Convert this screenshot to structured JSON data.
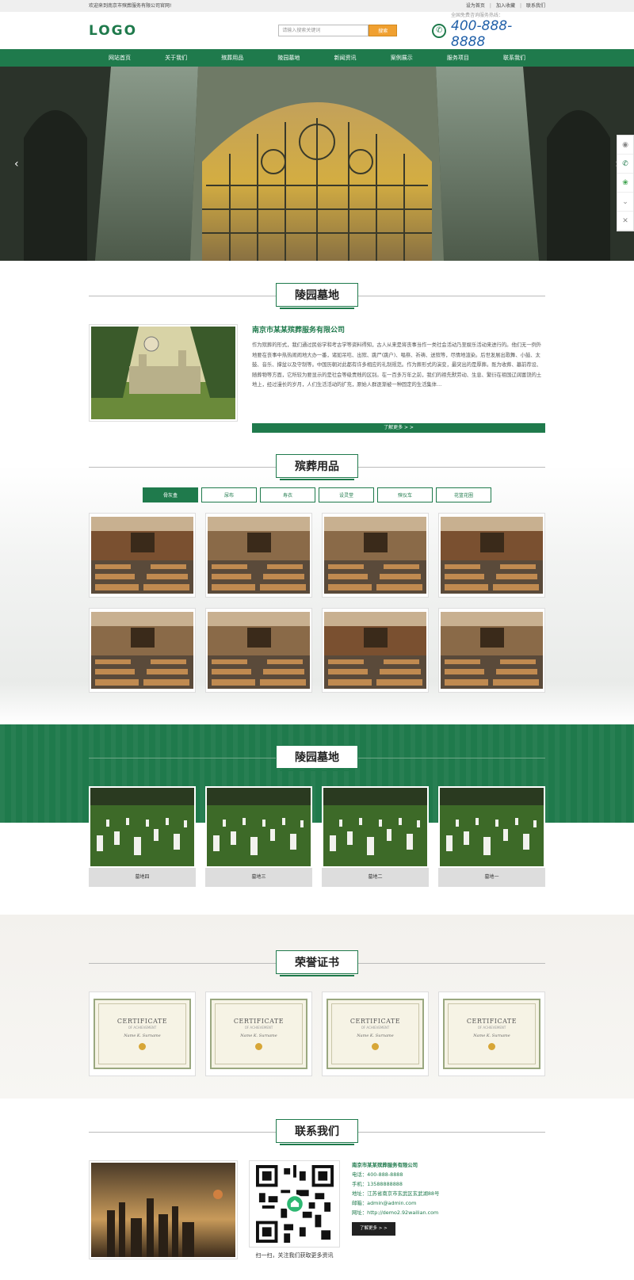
{
  "topbar": {
    "welcome": "欢迎来到南京市殡葬服务有限公司官网!",
    "links": [
      "设为首页",
      "加入收藏",
      "联系我们"
    ]
  },
  "header": {
    "logo": "LOGO",
    "search_placeholder": "请输入搜索关键词",
    "search_button": "搜索",
    "phone_label": "全国免费咨询服务热线：",
    "phone": "400-888-8888"
  },
  "nav": [
    "网站首页",
    "关于我们",
    "殡葬用品",
    "陵园墓地",
    "新闻资讯",
    "案例展示",
    "服务项目",
    "联系我们"
  ],
  "banner": {
    "prev": "‹",
    "next": "›"
  },
  "side_tools": [
    "qq-icon",
    "phone-icon",
    "wechat-icon",
    "down-icon",
    "close-icon"
  ],
  "about": {
    "title": "陵园墓地",
    "company": "南京市某某殡葬服务有限公司",
    "text": "作为殡葬的形式，我们通过民俗学和考古学等资料得知，古人从来是将丧事当作一类社会活动乃至娱乐活动来进行的。他们无一例外地要在丧事中热热闹闹地大办一番，诸如吊唁、出殡、跳尸(跳户)、唱祭、祈祷、送殡等，尽情地渲染。后世发展出歌舞、小鼓、太鼓、音乐、撑盆以及守制等。中国历朝对此都有许多相应的礼制规范。作为葬形式的演变，最突出的是厚葬。既为收葬、墓前荐设、随葬物等方面，它所较为要显示的是社会等级贵贱的区别。在一百多万年之前，我们的祖先默劳动、生息、繁衍在祖国辽阔富饶的土地上，经过漫长的岁月，人们生活活动的扩充，原始人群逐渐被一种固定的生活集体…",
    "more": "了解更多 > >"
  },
  "products": {
    "title": "殡葬用品",
    "tabs": [
      "骨灰盒",
      "尿布",
      "寿衣",
      "设灵堂",
      "殡仪车",
      "花篮花圈"
    ],
    "active_tab": 0
  },
  "cemetery": {
    "title": "陵园墓地",
    "items": [
      "墓地四",
      "墓地三",
      "墓地二",
      "墓地一"
    ]
  },
  "certs": {
    "title": "荣誉证书",
    "cert_title": "CERTIFICATE",
    "cert_sub": "OF ACHIEVEMENT",
    "cert_name": "Name K. Surname",
    "count": 4
  },
  "contact": {
    "title": "联系我们",
    "qr_caption": "扫一扫，关注我们获取更多资讯",
    "company": "南京市某某殡葬服务有限公司",
    "lines": [
      "电话：400-888-8888",
      "手机：13588888888",
      "地址：江苏省南京市玄武区玄武湖88号",
      "邮箱：admin@admin.com",
      "网址：http://demo2.92wailian.com"
    ],
    "more": "了解更多 > >"
  },
  "colors": {
    "brand": "#1f7a4c",
    "accent": "#f0a030",
    "phone": "#1f5fa8"
  }
}
